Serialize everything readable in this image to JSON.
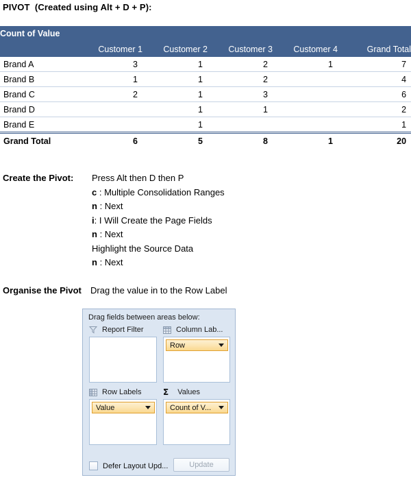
{
  "page": {
    "title": "PIVOT  (Created using Alt + D + P):"
  },
  "pivot": {
    "corner_label": "Count of Value",
    "row_header_blank": "",
    "columns": [
      "Customer 1",
      "Customer 2",
      "Customer 3",
      "Customer 4",
      "Grand Total"
    ],
    "rows": [
      {
        "label": "Brand A",
        "values": [
          "3",
          "1",
          "2",
          "1",
          "7"
        ]
      },
      {
        "label": "Brand B",
        "values": [
          "1",
          "1",
          "2",
          "",
          "4"
        ]
      },
      {
        "label": "Brand C",
        "values": [
          "2",
          "1",
          "3",
          "",
          "6"
        ]
      },
      {
        "label": "Brand D",
        "values": [
          "",
          "1",
          "1",
          "",
          "2"
        ]
      },
      {
        "label": "Brand E",
        "values": [
          "",
          "1",
          "",
          "",
          "1"
        ]
      }
    ],
    "total_row": {
      "label": "Grand Total",
      "values": [
        "6",
        "5",
        "8",
        "1",
        "20"
      ]
    },
    "header_color": "#43628F",
    "row_line_color": "#C6D3E4"
  },
  "create_pivot": {
    "label": "Create the Pivot:",
    "steps": [
      {
        "key": "",
        "text": "Press Alt then D then P"
      },
      {
        "key": "c",
        "text": " : Multiple Consolidation Ranges"
      },
      {
        "key": "n",
        "text": " : Next"
      },
      {
        "key": "i",
        "text": ": I Will Create the Page Fields"
      },
      {
        "key": "n",
        "text": " : Next"
      },
      {
        "key": "",
        "text": "Highlight the Source Data"
      },
      {
        "key": "n",
        "text": " : Next"
      }
    ]
  },
  "organise_pivot": {
    "label": "Organise the Pivot",
    "text": "Drag the value in to the Row Label"
  },
  "field_panel": {
    "caption": "Drag fields between areas below:",
    "zones": [
      {
        "id": "report-filter",
        "icon": "filter-funnel-icon",
        "label": "Report Filter",
        "pills": []
      },
      {
        "id": "column-labels",
        "icon": "column-grid-icon",
        "label": "Column Lab...",
        "pills": [
          "Row"
        ]
      },
      {
        "id": "row-labels",
        "icon": "row-grid-icon",
        "label": "Row Labels",
        "pills": [
          "Value"
        ]
      },
      {
        "id": "values",
        "icon": "sigma-icon",
        "label": "Values",
        "pills": [
          "Count of V..."
        ]
      }
    ],
    "defer_checkbox_label": "Defer Layout Upd...",
    "update_button_label": "Update",
    "panel_bg": "#DCE6F2",
    "pill_border": "#E0A030"
  }
}
